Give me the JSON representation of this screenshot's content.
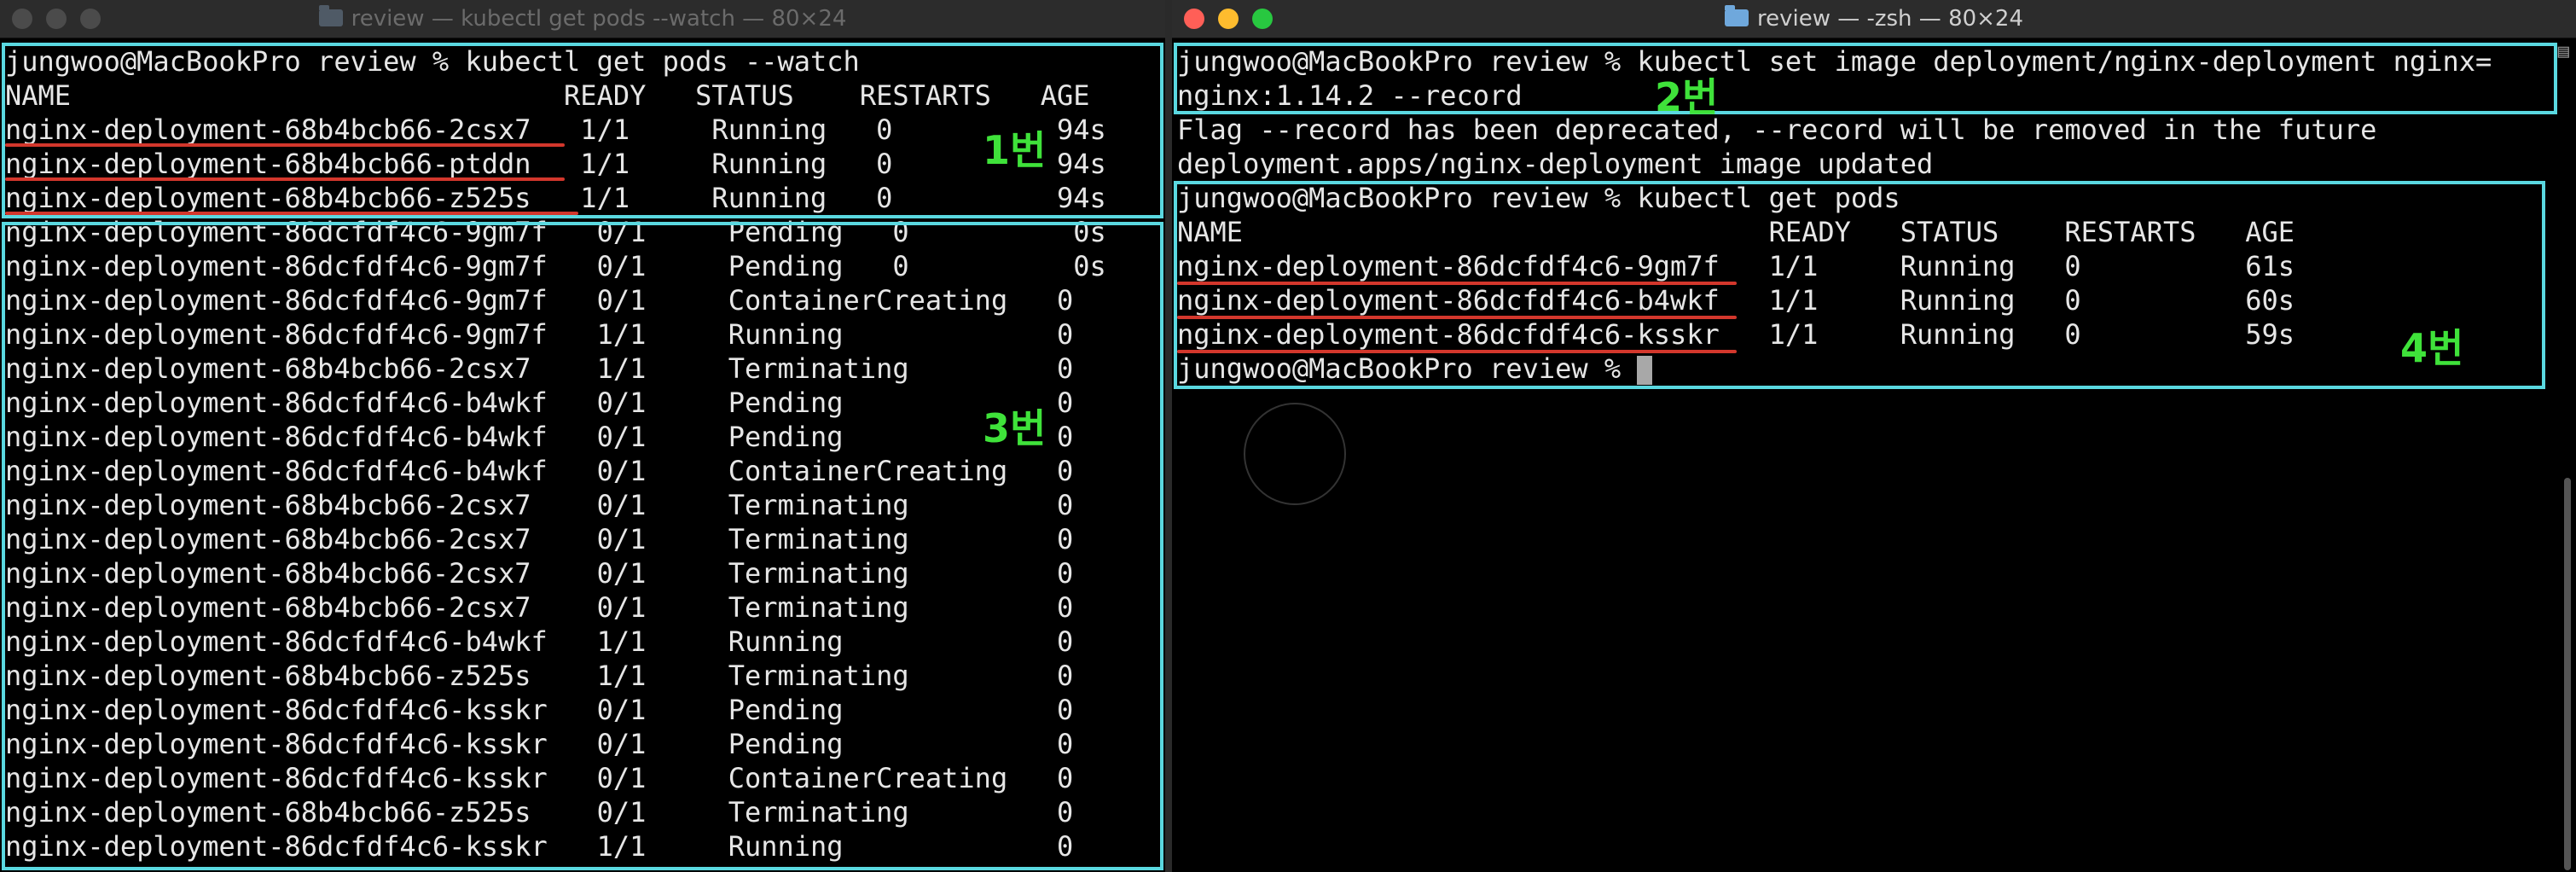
{
  "left_window": {
    "title": "review — kubectl get pods --watch — 80×24",
    "lines": [
      "jungwoo@MacBookPro review % kubectl get pods --watch",
      "NAME                              READY   STATUS    RESTARTS   AGE",
      "nginx-deployment-68b4bcb66-2csx7   1/1     Running   0          94s",
      "nginx-deployment-68b4bcb66-ptddn   1/1     Running   0          94s",
      "nginx-deployment-68b4bcb66-z525s   1/1     Running   0          94s",
      "nginx-deployment-86dcfdf4c6-9gm7f   0/1     Pending   0          0s",
      "nginx-deployment-86dcfdf4c6-9gm7f   0/1     Pending   0          0s",
      "nginx-deployment-86dcfdf4c6-9gm7f   0/1     ContainerCreating   0",
      "nginx-deployment-86dcfdf4c6-9gm7f   1/1     Running             0",
      "nginx-deployment-68b4bcb66-2csx7    1/1     Terminating         0",
      "nginx-deployment-86dcfdf4c6-b4wkf   0/1     Pending             0",
      "nginx-deployment-86dcfdf4c6-b4wkf   0/1     Pending             0",
      "nginx-deployment-86dcfdf4c6-b4wkf   0/1     ContainerCreating   0",
      "nginx-deployment-68b4bcb66-2csx7    0/1     Terminating         0",
      "nginx-deployment-68b4bcb66-2csx7    0/1     Terminating         0",
      "nginx-deployment-68b4bcb66-2csx7    0/1     Terminating         0",
      "nginx-deployment-68b4bcb66-2csx7    0/1     Terminating         0",
      "nginx-deployment-86dcfdf4c6-b4wkf   1/1     Running             0",
      "nginx-deployment-68b4bcb66-z525s    1/1     Terminating         0",
      "nginx-deployment-86dcfdf4c6-ksskr   0/1     Pending             0",
      "nginx-deployment-86dcfdf4c6-ksskr   0/1     Pending             0",
      "nginx-deployment-86dcfdf4c6-ksskr   0/1     ContainerCreating   0",
      "nginx-deployment-68b4bcb66-z525s    0/1     Terminating         0",
      "nginx-deployment-86dcfdf4c6-ksskr   1/1     Running             0"
    ],
    "annotations": {
      "label_1": "1번",
      "label_3": "3번"
    }
  },
  "right_window": {
    "title": "review — -zsh — 80×24",
    "lines": [
      "jungwoo@MacBookPro review % kubectl set image deployment/nginx-deployment nginx=",
      "nginx:1.14.2 --record",
      "Flag --record has been deprecated, --record will be removed in the future",
      "deployment.apps/nginx-deployment image updated",
      "jungwoo@MacBookPro review % kubectl get pods",
      "NAME                                READY   STATUS    RESTARTS   AGE",
      "nginx-deployment-86dcfdf4c6-9gm7f   1/1     Running   0          61s",
      "nginx-deployment-86dcfdf4c6-b4wkf   1/1     Running   0          60s",
      "nginx-deployment-86dcfdf4c6-ksskr   1/1     Running   0          59s",
      "jungwoo@MacBookPro review % "
    ],
    "annotations": {
      "label_2": "2번",
      "label_4": "4번"
    }
  },
  "colors": {
    "highlight_box": "#5ad8e0",
    "underline": "#d3372c",
    "annotation_text": "#3fe23a",
    "terminal_text": "#e6e6e6"
  }
}
